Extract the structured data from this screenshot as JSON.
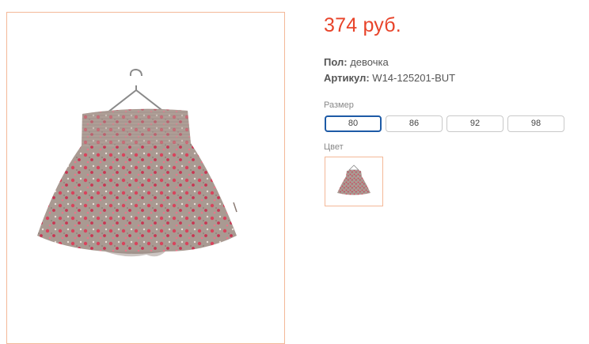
{
  "product": {
    "price": "374 руб.",
    "attributes": [
      {
        "label": "Пол:",
        "value": "девочка"
      },
      {
        "label": "Артикул:",
        "value": "W14-125201-BUT"
      }
    ]
  },
  "sizes": {
    "label": "Размер",
    "options": [
      "80",
      "86",
      "92",
      "98"
    ],
    "selected": "80"
  },
  "colors": {
    "label": "Цвет",
    "swatches": [
      {
        "icon": "floral-skirt-thumbnail"
      }
    ]
  },
  "theme": {
    "price_color": "#e8442a",
    "frame_border": "#f4b898",
    "selected_size_border": "#1d5aa6",
    "fabric_base": "#a99a92",
    "fabric_flower": "#d8435c"
  }
}
